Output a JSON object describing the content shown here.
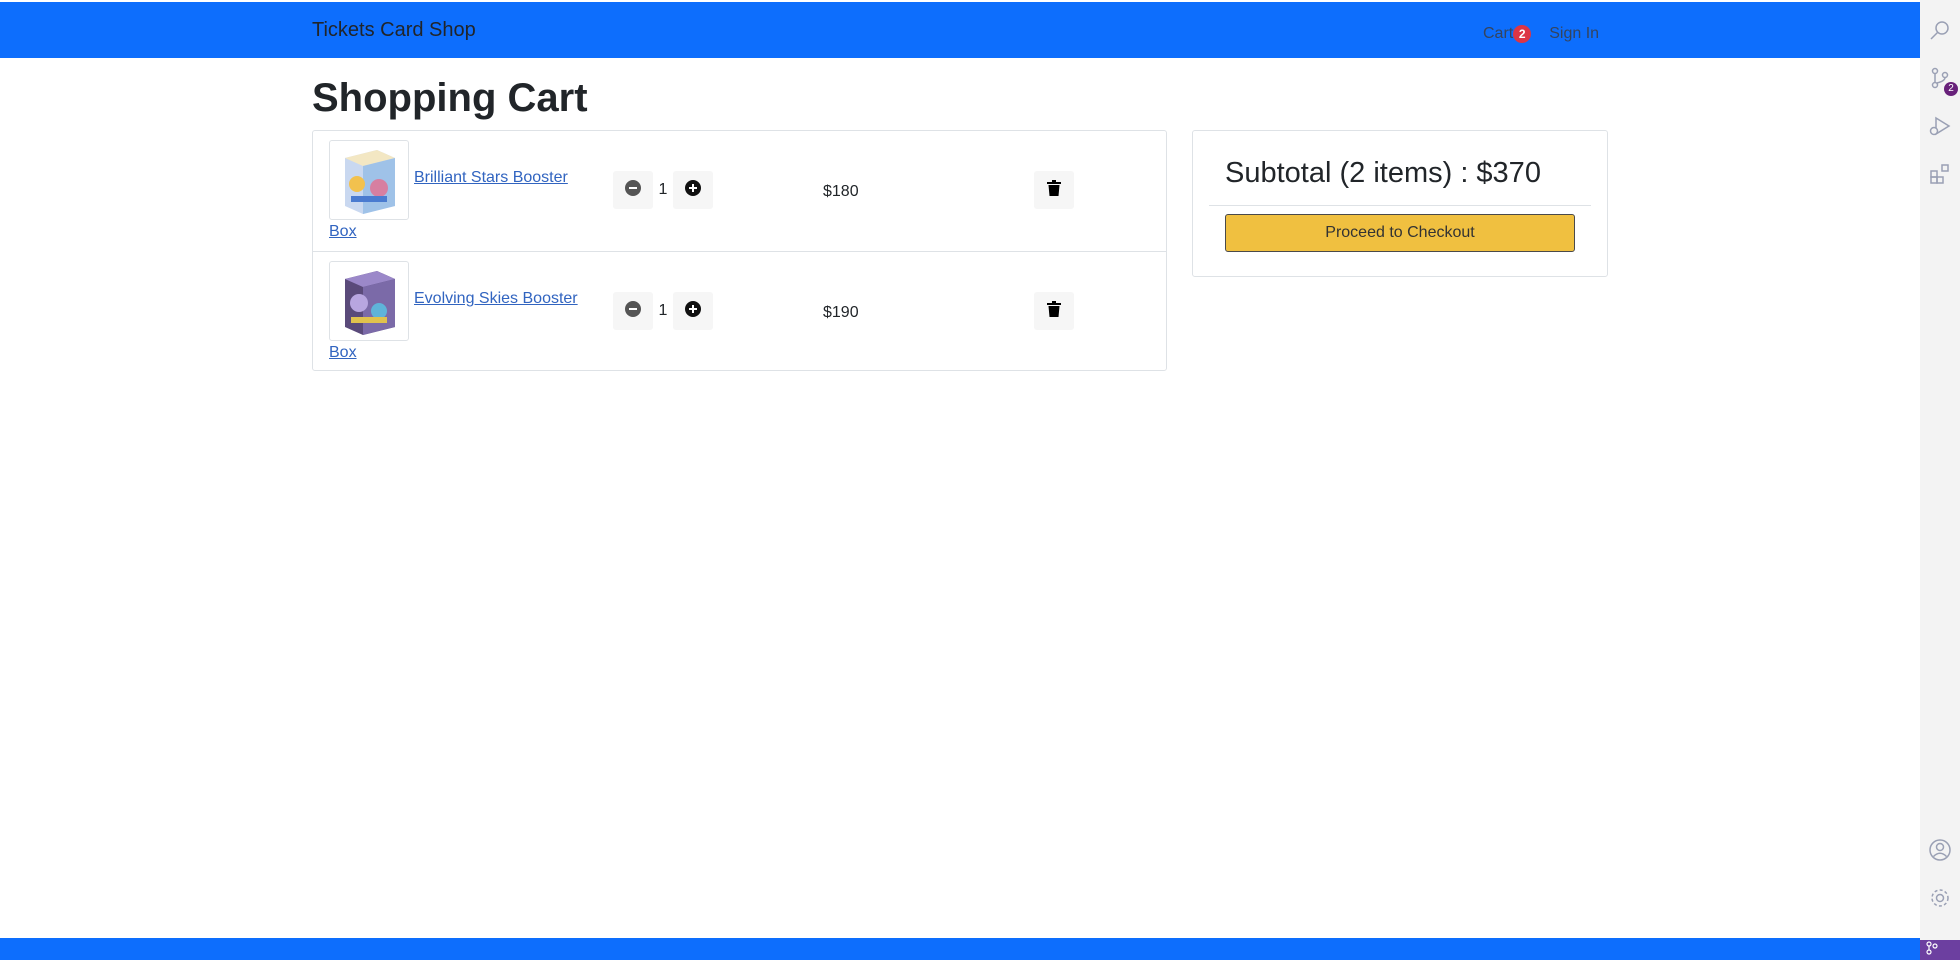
{
  "navbar": {
    "brand": "Tickets Card Shop",
    "cart_label": "Cart",
    "cart_count": "2",
    "signin_label": "Sign In"
  },
  "page": {
    "title": "Shopping Cart"
  },
  "cart": {
    "items": [
      {
        "name_line1": "Brilliant Stars Booster",
        "name_line2": "Box",
        "quantity": "1",
        "price": "$180",
        "image_icon": "booster-box-image"
      },
      {
        "name_line1": "Evolving Skies Booster",
        "name_line2": "Box",
        "quantity": "1",
        "price": "$190",
        "image_icon": "booster-box-image"
      }
    ]
  },
  "summary": {
    "subtotal": "Subtotal (2 items) : $370",
    "checkout_label": "Proceed to Checkout"
  },
  "activity_bar": {
    "scm_badge": "2",
    "icons": [
      "search-icon",
      "source-control-icon",
      "run-debug-icon",
      "extensions-icon",
      "account-icon",
      "settings-gear-icon"
    ]
  },
  "colors": {
    "primary": "#0d6efd",
    "checkout": "#f0c040",
    "badge": "#dc3545"
  }
}
